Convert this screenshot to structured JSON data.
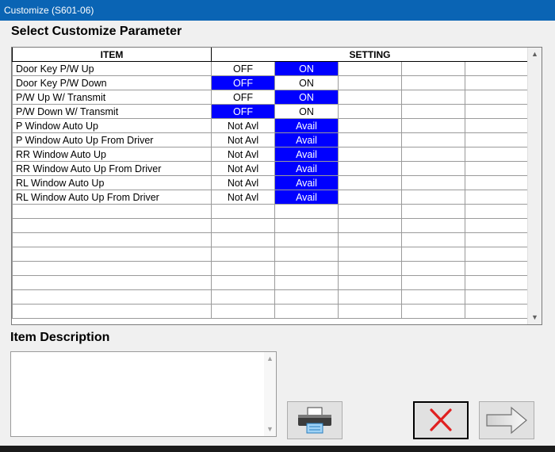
{
  "window": {
    "title": "Customize (S601-06)"
  },
  "main": {
    "heading": "Select Customize Parameter"
  },
  "table": {
    "columns": {
      "item": "ITEM",
      "setting": "SETTING"
    },
    "rows": [
      {
        "item": "Door Key P/W Up",
        "options": [
          "OFF",
          "ON"
        ],
        "selected": 1
      },
      {
        "item": "Door Key P/W Down",
        "options": [
          "OFF",
          "ON"
        ],
        "selected": 0
      },
      {
        "item": "P/W Up W/ Transmit",
        "options": [
          "OFF",
          "ON"
        ],
        "selected": 1
      },
      {
        "item": "P/W Down W/ Transmit",
        "options": [
          "OFF",
          "ON"
        ],
        "selected": 0
      },
      {
        "item": "P Window Auto Up",
        "options": [
          "Not Avl",
          "Avail"
        ],
        "selected": 1
      },
      {
        "item": "P Window Auto Up From Driver",
        "options": [
          "Not Avl",
          "Avail"
        ],
        "selected": 1
      },
      {
        "item": "RR Window Auto Up",
        "options": [
          "Not Avl",
          "Avail"
        ],
        "selected": 1
      },
      {
        "item": "RR Window Auto Up From Driver",
        "options": [
          "Not Avl",
          "Avail"
        ],
        "selected": 1
      },
      {
        "item": "RL Window Auto Up",
        "options": [
          "Not Avl",
          "Avail"
        ],
        "selected": 1
      },
      {
        "item": "RL Window Auto Up From Driver",
        "options": [
          "Not Avl",
          "Avail"
        ],
        "selected": 1
      }
    ],
    "empty_rows": 8,
    "selected_color": "#0000ff"
  },
  "description": {
    "heading": "Item Description",
    "text": ""
  },
  "toolbar": {
    "print_icon": "printer-icon",
    "cancel_icon": "red-x-icon",
    "next_icon": "right-arrow-icon"
  }
}
